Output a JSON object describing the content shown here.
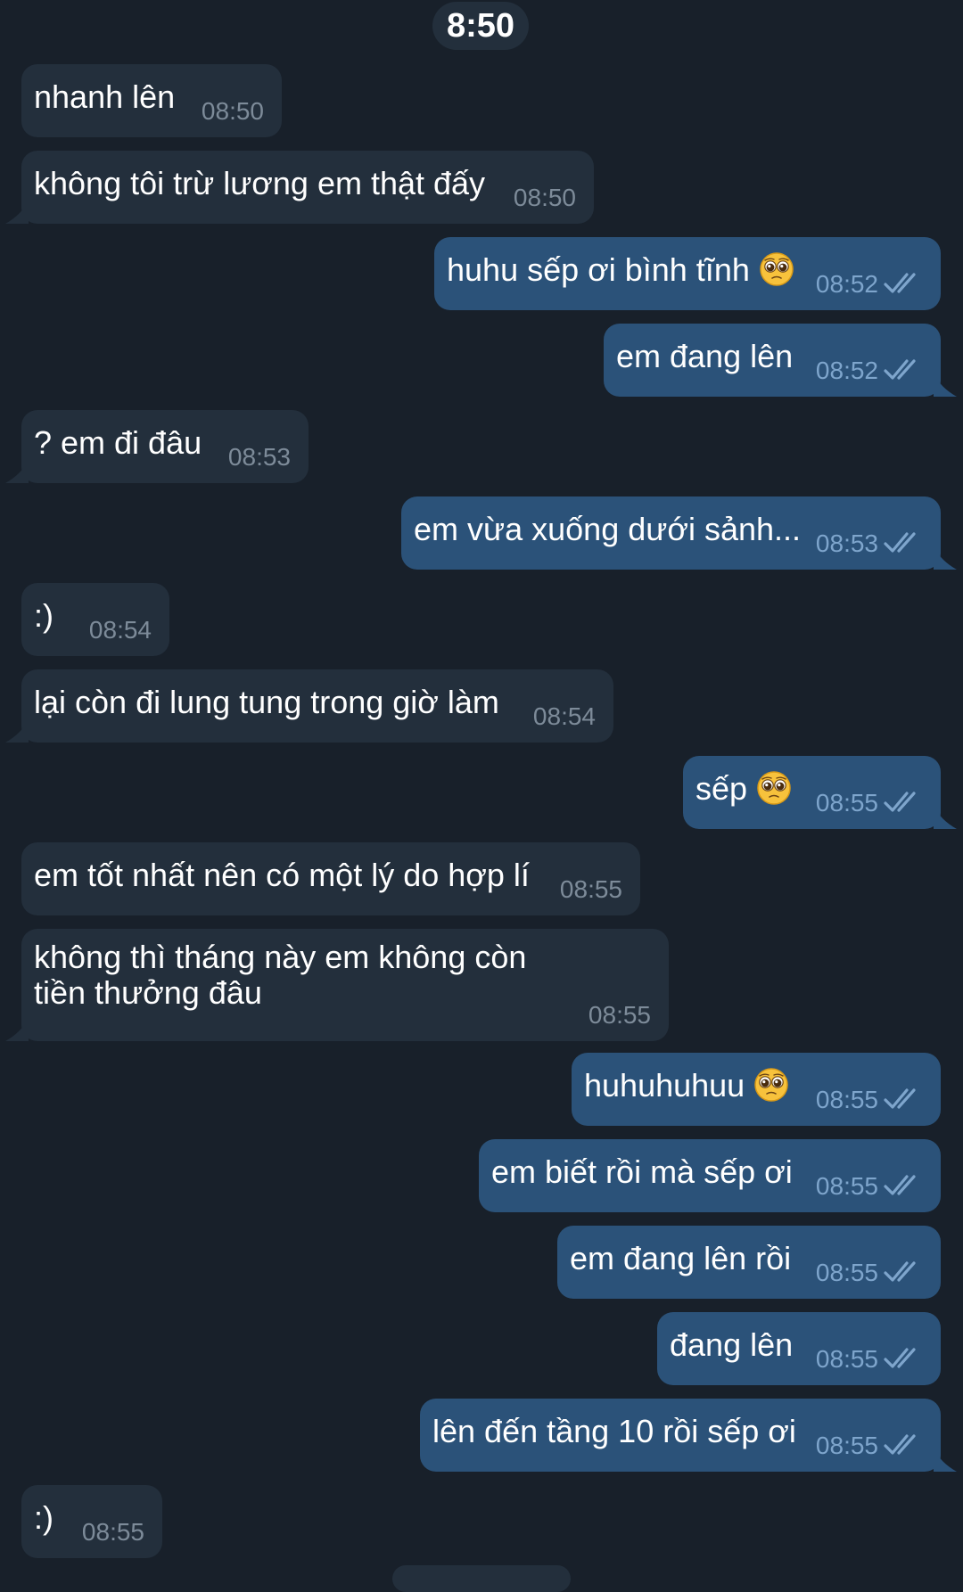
{
  "date_header": "8:50",
  "messages": [
    {
      "text": "nhanh lên",
      "time": "08:50"
    },
    {
      "text": "không tôi trừ lương em thật đấy",
      "time": "08:50"
    },
    {
      "text": "huhu sếp ơi bình tĩnh",
      "time": "08:52",
      "emoji": "pleading-face"
    },
    {
      "text": "em đang lên",
      "time": "08:52"
    },
    {
      "text": "? em đi đâu",
      "time": "08:53"
    },
    {
      "text": "em vừa xuống dưới sảnh...",
      "time": "08:53"
    },
    {
      "text": ":)",
      "time": "08:54"
    },
    {
      "text": "lại còn đi lung tung trong giờ làm",
      "time": "08:54"
    },
    {
      "text": "sếp",
      "time": "08:55",
      "emoji": "pleading-face"
    },
    {
      "text": "em tốt nhất nên có một lý do hợp lí",
      "time": "08:55"
    },
    {
      "text": "không thì tháng này em không còn tiền thưởng đâu",
      "time": "08:55"
    },
    {
      "text": "huhuhuhuu",
      "time": "08:55",
      "emoji": "pleading-face"
    },
    {
      "text": "em biết rồi mà sếp ơi",
      "time": "08:55"
    },
    {
      "text": "em đang lên rồi",
      "time": "08:55"
    },
    {
      "text": "đang lên",
      "time": "08:55"
    },
    {
      "text": "lên đến tầng 10 rồi sếp ơi",
      "time": "08:55"
    },
    {
      "text": ":)",
      "time": "08:55"
    }
  ],
  "colors": {
    "background": "#18202a",
    "incoming_bubble": "#232f3c",
    "outgoing_bubble": "#2b5279",
    "incoming_time": "#7d8b99",
    "outgoing_time": "#7ea5cc",
    "read_check": "#7ea5cc"
  },
  "icons": {
    "read_receipt": "double-check-icon",
    "emoji": "pleading-face-emoji"
  }
}
